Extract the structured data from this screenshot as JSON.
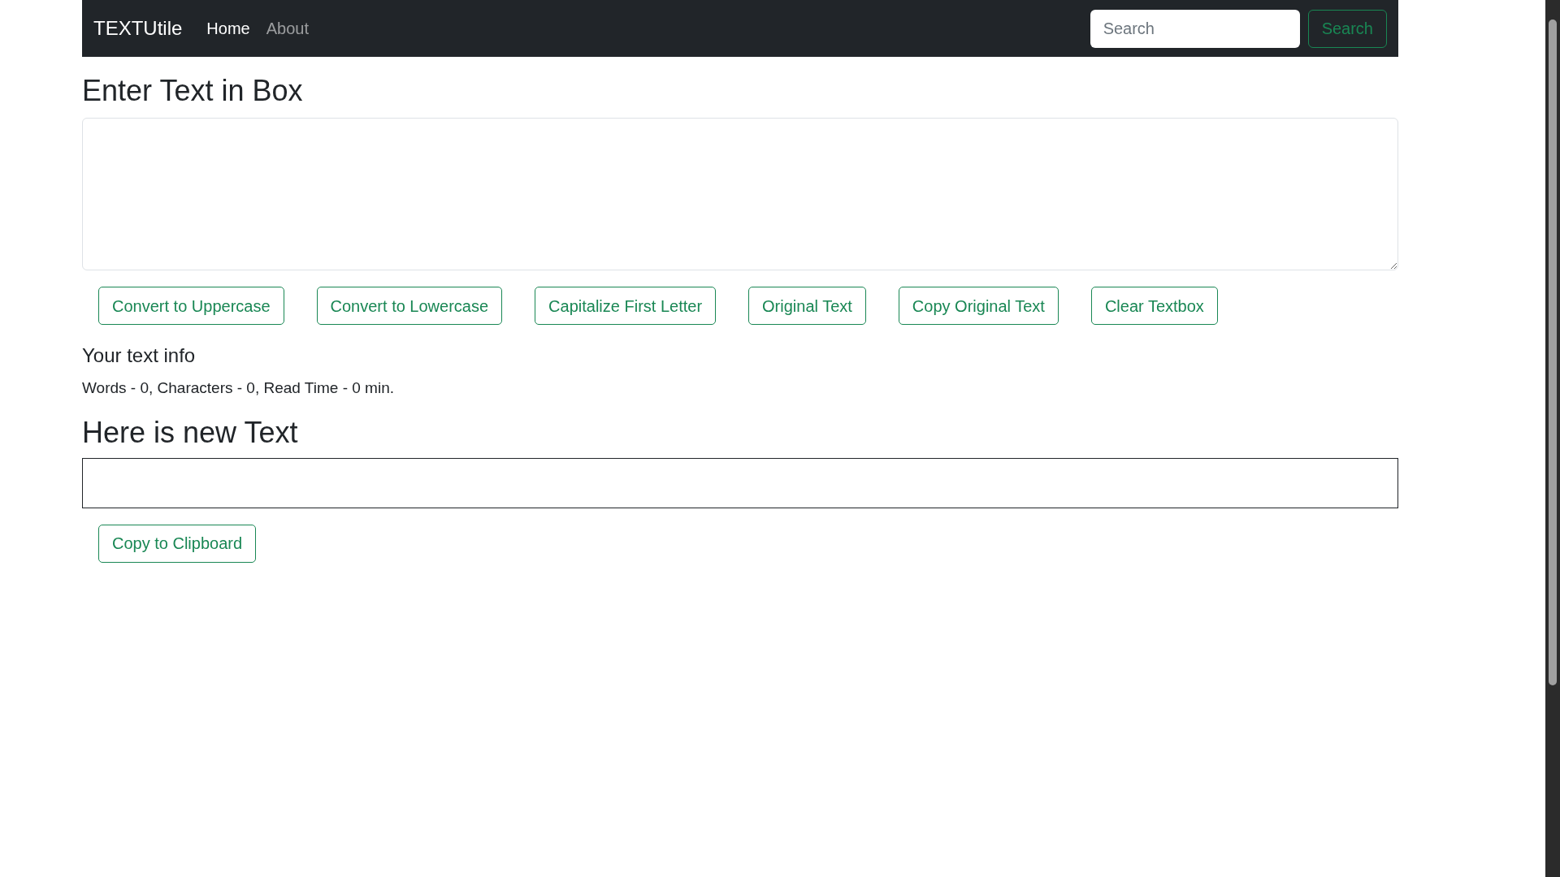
{
  "navbar": {
    "brand": "TEXTUtile",
    "links": [
      {
        "label": "Home",
        "selected": true
      },
      {
        "label": "About",
        "selected": false
      }
    ],
    "search": {
      "placeholder": "Search"
    },
    "search_button": "Search"
  },
  "input_section": {
    "heading": "Enter Text in Box",
    "buttons": [
      "Convert to Uppercase",
      "Convert to Lowercase",
      "Capitalize First Letter",
      "Original Text",
      "Copy Original Text",
      "Clear Textbox"
    ]
  },
  "info": {
    "heading": "Your text info",
    "summary": "Words - 0, Characters - 0, Read Time - 0 min."
  },
  "output_section": {
    "heading": "Here is new Text",
    "buttons": [
      "Copy to Clipboard"
    ]
  }
}
